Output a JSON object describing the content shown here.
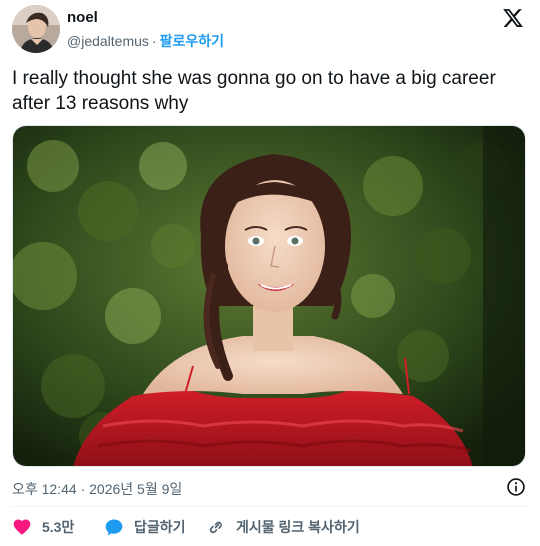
{
  "author": {
    "name": "noel",
    "handle": "@jedaltemus",
    "separator": "·",
    "follow_label": "팔로우하기"
  },
  "tweet": {
    "text": "I really thought she was gonna go on to have a big career after 13 reasons why"
  },
  "meta": {
    "timestamp": "오후 12:44 · 2026년 5월 9일"
  },
  "actions": {
    "like_count": "5.3만",
    "reply_label": "답글하기",
    "copy_link_label": "게시물 링크 복사하기"
  },
  "colors": {
    "like": "#f91880",
    "reply": "#1d9bf0",
    "follow": "#1d9bf0",
    "secondary_text": "#536471"
  },
  "icons": [
    "x-logo-icon",
    "info-icon",
    "heart-icon",
    "reply-bubble-icon",
    "link-icon"
  ]
}
